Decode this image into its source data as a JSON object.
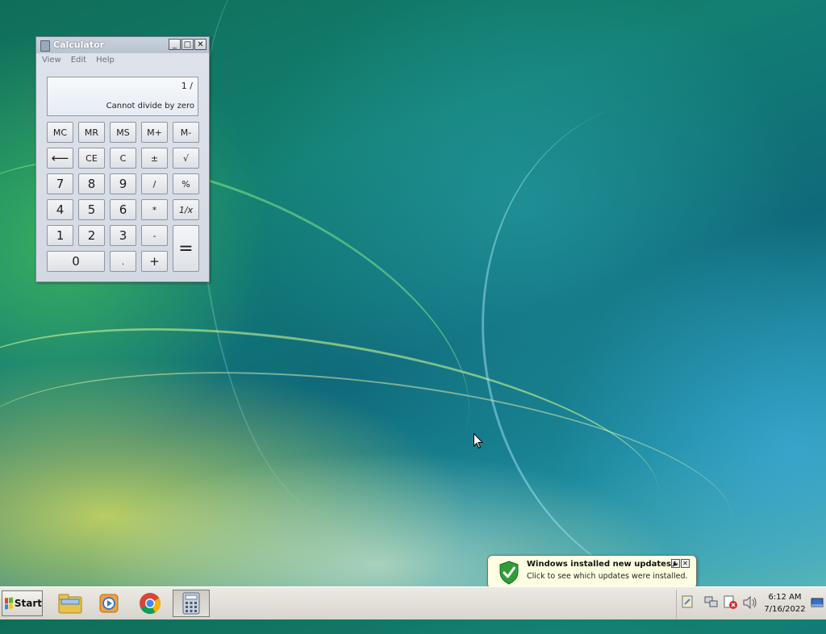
{
  "calculator": {
    "title": "Calculator",
    "window_buttons": {
      "minimize": "_",
      "maximize": "□",
      "close": "✕"
    },
    "menu": [
      "View",
      "Edit",
      "Help"
    ],
    "display": {
      "expression": "1 /",
      "value": "Cannot divide by zero"
    },
    "keys": {
      "mc": "MC",
      "mr": "MR",
      "ms": "MS",
      "mplus": "M+",
      "mminus": "M-",
      "back": "⟵",
      "ce": "CE",
      "c": "C",
      "plusminus": "±",
      "sqrt": "√",
      "k7": "7",
      "k8": "8",
      "k9": "9",
      "div": "/",
      "pct": "%",
      "k4": "4",
      "k5": "5",
      "k6": "6",
      "mul": "*",
      "recip": "1/x",
      "k1": "1",
      "k2": "2",
      "k3": "3",
      "sub": "-",
      "eq": "=",
      "k0": "0",
      "dot": ".",
      "add": "+"
    }
  },
  "notification": {
    "title": "Windows installed new updates",
    "text": "Click to see which updates were installed.",
    "close": "✕",
    "icon": "shield-check-icon"
  },
  "taskbar": {
    "start_label": "Start",
    "apps": [
      "file-explorer-icon",
      "media-player-icon",
      "chrome-icon",
      "calculator-icon"
    ],
    "clock_time": "6:12 AM",
    "clock_date": "7/16/2022"
  },
  "colors": {
    "accent_green": "#2e9e3a",
    "balloon_bg": "#ffffe1"
  }
}
